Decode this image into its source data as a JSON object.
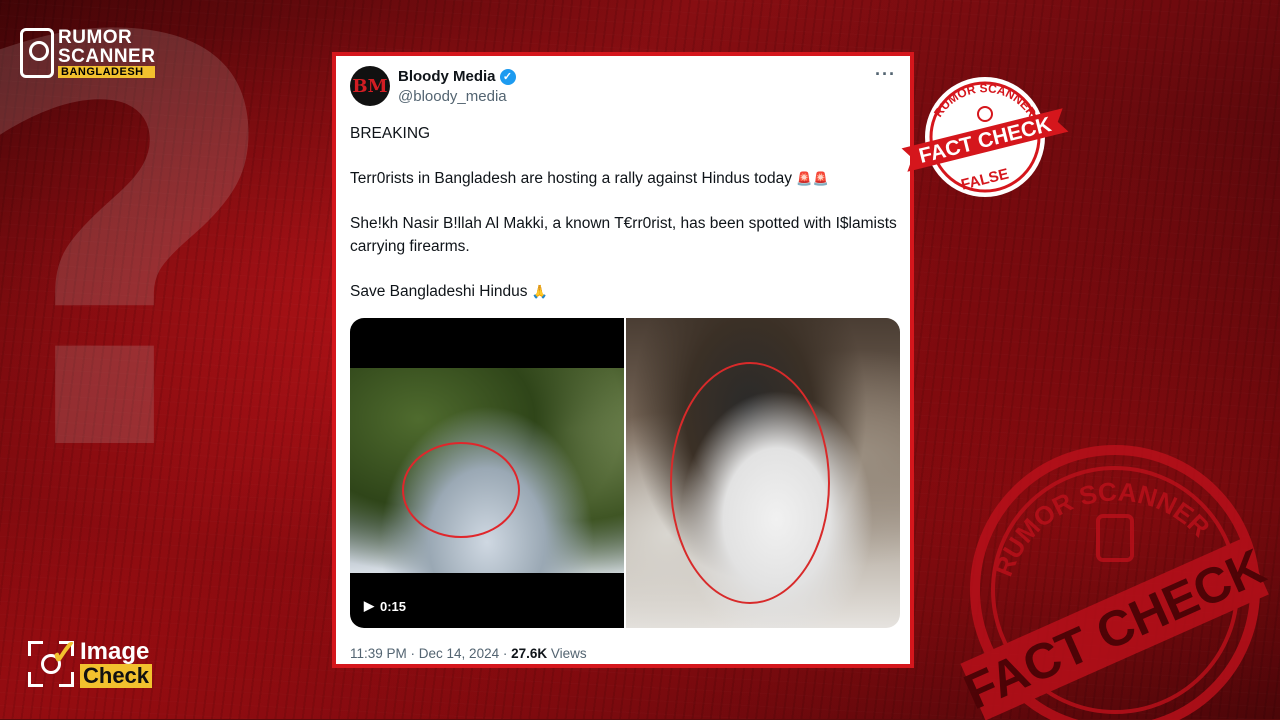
{
  "brand": {
    "rumor_line1": "RUMOR",
    "rumor_line2": "SCANNER",
    "rumor_line3": "BANGLADESH",
    "image_check_1": "Image",
    "image_check_2": "Check",
    "accent_red": "#d5161c",
    "accent_yellow": "#f2c12e"
  },
  "tweet": {
    "display_name": "Bloody Media",
    "handle": "@bloody_media",
    "avatar_text": "BM",
    "more_label": "···",
    "paragraphs": {
      "p1": "BREAKING",
      "p2": "Terr0rists in Bangladesh are hosting a rally against Hindus today",
      "p2_emoji": "🚨🚨",
      "p3": "She!kh Nasir B!llah Al Makki, a known T€rr0rist, has been spotted with I$lamists carrying firearms.",
      "p4": "Save Bangladeshi Hindus",
      "p4_emoji": "🙏"
    },
    "video_duration": "0:15",
    "timestamp": "11:39 PM · Dec 14, 2024 · ",
    "views_count": "27.6K",
    "views_label": " Views"
  },
  "stamps": {
    "top_ring": "RUMOR SCANNER",
    "top_banner": "FACT CHECK",
    "top_verdict": "FALSE",
    "big_ring": "RUMOR SCANNER",
    "big_banner": "FACT CHECK"
  }
}
